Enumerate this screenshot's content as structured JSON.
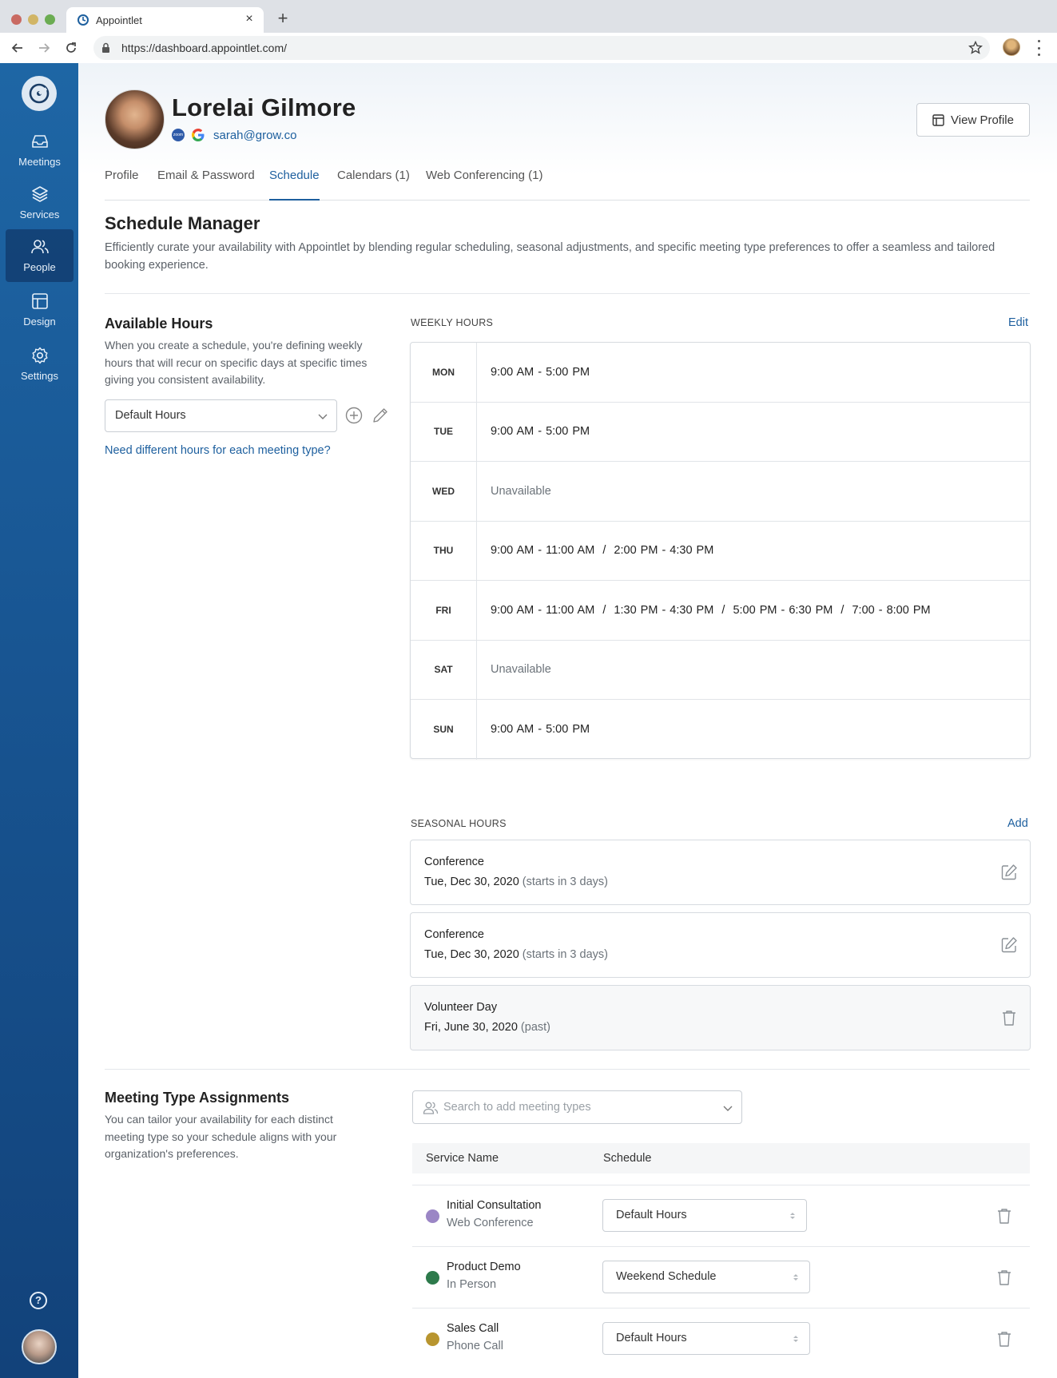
{
  "browser": {
    "tab_title": "Appointlet",
    "tab_close": "×",
    "new_tab": "+",
    "url": "https://dashboard.appointlet.com/"
  },
  "sidebar": {
    "items": [
      {
        "label": "Meetings",
        "icon": "inbox-icon"
      },
      {
        "label": "Services",
        "icon": "layers-icon"
      },
      {
        "label": "People",
        "icon": "users-icon",
        "active": true
      },
      {
        "label": "Design",
        "icon": "layout-icon"
      },
      {
        "label": "Settings",
        "icon": "gear-icon"
      }
    ],
    "help": "?"
  },
  "profile": {
    "name": "Lorelai Gilmore",
    "zoom_badge": "zoom",
    "email": "sarah@grow.co",
    "view_profile": "View Profile"
  },
  "tabs": [
    {
      "label": "Profile"
    },
    {
      "label": "Email & Password"
    },
    {
      "label": "Schedule",
      "active": true
    },
    {
      "label": "Calendars (1)"
    },
    {
      "label": "Web Conferencing (1)"
    }
  ],
  "schedule_manager": {
    "title": "Schedule Manager",
    "description": "Efficiently curate your availability with Appointlet by blending regular scheduling, seasonal adjustments, and specific meeting type preferences to offer a seamless and tailored booking experience."
  },
  "available_hours": {
    "title": "Available Hours",
    "description": "When you create a schedule, you're defining weekly hours that will recur on specific days at specific times giving you consistent availability.",
    "selected": "Default Hours",
    "link": "Need different hours for each meeting type?"
  },
  "weekly_hours": {
    "label": "WEEKLY HOURS",
    "edit": "Edit",
    "rows": [
      {
        "day": "MON",
        "hours": "9:00 AM - 5:00 PM",
        "available": true
      },
      {
        "day": "TUE",
        "hours": "9:00 AM - 5:00 PM",
        "available": true
      },
      {
        "day": "WED",
        "hours": "Unavailable",
        "available": false
      },
      {
        "day": "THU",
        "hours": "9:00 AM - 11:00 AM  /  2:00 PM - 4:30 PM",
        "available": true
      },
      {
        "day": "FRI",
        "hours": "9:00 AM - 11:00 AM  /  1:30 PM - 4:30 PM  /  5:00 PM - 6:30 PM  /  7:00 - 8:00 PM",
        "available": true
      },
      {
        "day": "SAT",
        "hours": "Unavailable",
        "available": false
      },
      {
        "day": "SUN",
        "hours": "9:00 AM - 5:00 PM",
        "available": true
      }
    ]
  },
  "seasonal_hours": {
    "label": "SEASONAL HOURS",
    "add": "Add",
    "items": [
      {
        "name": "Conference",
        "date": "Tue, Dec 30, 2020",
        "status": "(starts in 3 days)",
        "action": "edit"
      },
      {
        "name": "Conference",
        "date": "Tue, Dec 30, 2020",
        "status": "(starts in 3 days)",
        "action": "edit"
      },
      {
        "name": "Volunteer Day",
        "date": "Fri, June 30, 2020",
        "status": "(past)",
        "action": "delete"
      }
    ]
  },
  "meeting_types": {
    "title": "Meeting Type Assignments",
    "description": "You can tailor your availability for each distinct meeting type so your schedule aligns with your organization's preferences.",
    "search_placeholder": "Search to add meeting types",
    "columns": [
      "Service Name",
      "Schedule"
    ],
    "rows": [
      {
        "name": "Initial Consultation",
        "location": "Web Conference",
        "color": "#9b86c5",
        "schedule": "Default Hours"
      },
      {
        "name": "Product Demo",
        "location": "In Person",
        "color": "#2d7a4b",
        "schedule": "Weekend Schedule"
      },
      {
        "name": "Sales Call",
        "location": "Phone Call",
        "color": "#b8952f",
        "schedule": "Default Hours"
      }
    ]
  },
  "colors": {
    "brand_blue": "#1d5f9e",
    "sidebar_top": "#1e66a5",
    "sidebar_bottom": "#12427a"
  }
}
